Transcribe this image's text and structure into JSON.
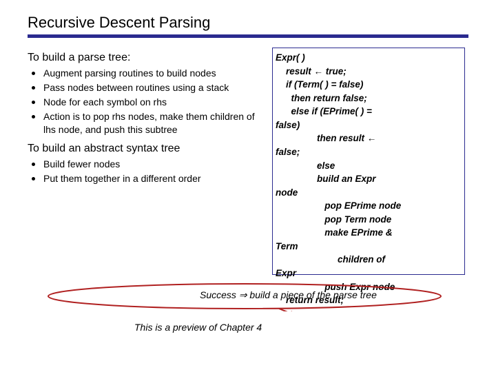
{
  "title": "Recursive Descent Parsing",
  "left": {
    "subhead1": "To build a parse tree:",
    "bullets1": [
      "Augment parsing routines to build nodes",
      "Pass nodes between routines using a stack",
      "Node for each symbol on rhs",
      "Action is to pop rhs nodes, make them children of lhs node, and push this subtree"
    ],
    "subhead2": "To build an abstract syntax tree",
    "bullets2": [
      "Build fewer nodes",
      "Put them together in a different order"
    ]
  },
  "code": {
    "l1": "Expr( )",
    "l2": "    result ← true;",
    "l3": "    if (Term( ) = false)",
    "l4": "      then return false;",
    "l5": "      else if (EPrime( ) =",
    "l6": "false)",
    "l7": "                then result ←",
    "l8": "false;",
    "l9": "                else",
    "l10": "                build an Expr",
    "l11": "node",
    "l12": "                   pop EPrime node",
    "l13": "                   pop Term node",
    "l14": "                   make EPrime &",
    "l15": "Term",
    "l16": "                        children of",
    "l17": "Expr",
    "l18": "                   push Expr node",
    "l19": "    return result;"
  },
  "annot1_a": "Success ⇒ ",
  "annot1_b": "build a piece of the parse tree",
  "annot2": "This is a preview of Chapter 4"
}
